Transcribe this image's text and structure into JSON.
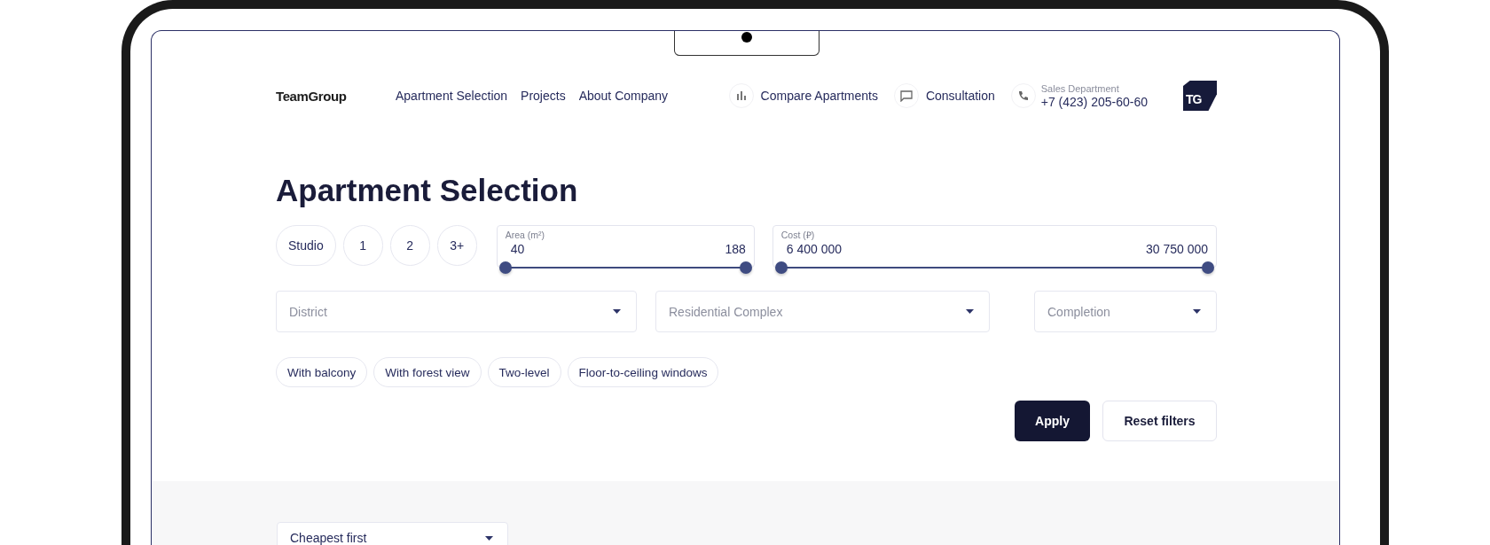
{
  "header": {
    "logo": "TeamGroup",
    "nav": [
      {
        "label": "Apartment Selection"
      },
      {
        "label": "Projects"
      },
      {
        "label": "About Company"
      }
    ],
    "compare": {
      "label": "Compare Apartments"
    },
    "consultation": {
      "label": "Consultation"
    },
    "sales": {
      "caption": "Sales Department",
      "phone": "+7 (423) 205-60-60"
    },
    "logo_mark": "TG"
  },
  "title": "Apartment Selection",
  "rooms": [
    {
      "label": "Studio",
      "selected": false
    },
    {
      "label": "1",
      "selected": false
    },
    {
      "label": "2",
      "selected": false
    },
    {
      "label": "3+",
      "selected": false
    }
  ],
  "ranges": [
    {
      "label": "Area (m²)",
      "min": "40",
      "max": "188",
      "thumbs": [
        {
          "level": 0
        },
        {
          "level": 1
        }
      ]
    },
    {
      "label": "Cost (₽)",
      "min": "6 400 000",
      "max": "30 750 000",
      "thumbs": [
        {
          "level": 0
        },
        {
          "level": 1
        }
      ]
    }
  ],
  "dropdowns": [
    {
      "placeholder": "District"
    },
    {
      "placeholder": "Residential Complex"
    },
    {
      "placeholder": "Completion"
    }
  ],
  "tags": [
    {
      "label": "With balcony",
      "selected": false
    },
    {
      "label": "With forest view",
      "selected": false
    },
    {
      "label": "Two-level",
      "selected": false
    },
    {
      "label": "Floor-to-ceiling windows",
      "selected": false
    }
  ],
  "actions": [
    {
      "kind": "primary",
      "label": "Apply"
    },
    {
      "kind": "secondary",
      "label": "Reset filters"
    }
  ],
  "sort": {
    "value": "Cheapest first"
  }
}
